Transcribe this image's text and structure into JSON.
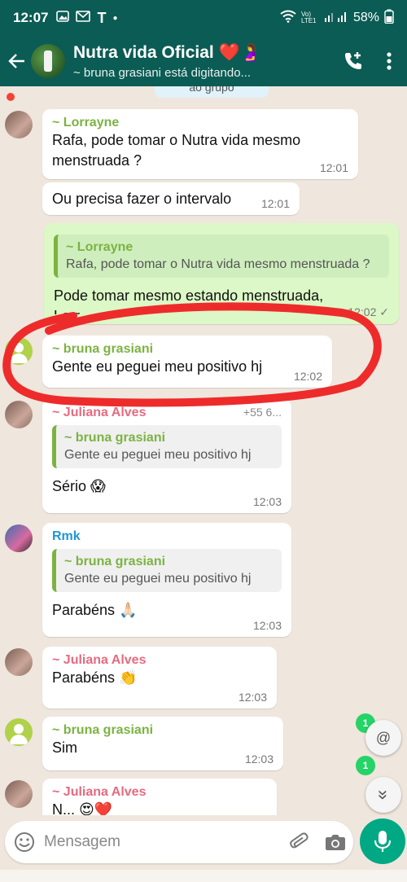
{
  "status_bar": {
    "time": "12:07",
    "notif_letter": "T",
    "battery": "58%",
    "lte_label": "Vo) LTE1"
  },
  "header": {
    "group_name": "Nutra vida Oficial ❤️🤰",
    "typing_status": "~ bruna grasiani está digitando..."
  },
  "system_message": "ao grupo",
  "messages": [
    {
      "sender": "~ Lorrayne",
      "sender_color": "#7cb342",
      "text": "Rafa, pode tomar o Nutra vida mesmo menstruada ?",
      "time": "12:01"
    },
    {
      "text": "Ou precisa fazer o intervalo",
      "time": "12:01"
    },
    {
      "outgoing": true,
      "quote_name": "~ Lorrayne",
      "quote_text": "Rafa, pode tomar o Nutra vida mesmo menstruada ?",
      "text": "Pode tomar mesmo estando menstruada,",
      "text_cut": "Lorr...",
      "time": "12:02 ✓"
    },
    {
      "sender": "~ bruna grasiani",
      "sender_color": "#7cb342",
      "text": "Gente eu peguei meu positivo hj",
      "time": "12:02"
    },
    {
      "sender": "~ Juliana Alves",
      "sender_color": "#e56b80",
      "phone": "+55 6...",
      "quote_name": "~ bruna grasiani",
      "quote_text": "Gente eu peguei meu positivo hj",
      "text": "Sério 😱",
      "time": "12:03"
    },
    {
      "sender": "Rmk",
      "sender_color": "#2196d3",
      "quote_name": "~ bruna grasiani",
      "quote_text": "Gente eu peguei meu positivo hj",
      "text": "Parabéns 🙏🏻",
      "time": "12:03"
    },
    {
      "sender": "~ Juliana Alves",
      "sender_color": "#e56b80",
      "text": "Parabéns 👏",
      "time": "12:03"
    },
    {
      "sender": "~ bruna grasiani",
      "sender_color": "#7cb342",
      "text": "Sim",
      "time": "12:03"
    },
    {
      "sender": "~ Juliana Alves",
      "sender_color": "#e56b80",
      "text": "N... 😍❤️"
    }
  ],
  "floating": {
    "mention_badge": "1",
    "mention_icon": "@",
    "scroll_badge": "1",
    "scroll_icon": "»"
  },
  "composer": {
    "placeholder": "Mensagem"
  },
  "colors": {
    "header_bg": "#0a5c54",
    "chat_bg": "#efe6dd",
    "outgoing_bubble": "#dcf8c6",
    "highlight": "#ee2b2b",
    "accent": "#00a884"
  }
}
